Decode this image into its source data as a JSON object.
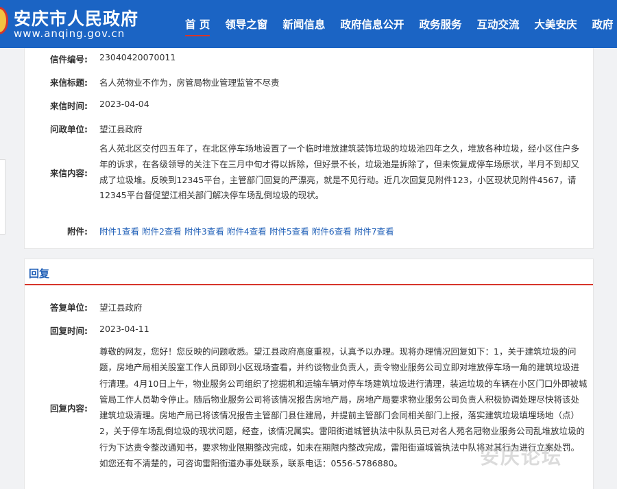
{
  "header": {
    "site_title": "安庆市人民政府",
    "site_url": "www.anqing.gov.cn",
    "nav": [
      {
        "label": "首 页"
      },
      {
        "label": "领导之窗"
      },
      {
        "label": "新闻信息"
      },
      {
        "label": "政府信息公开"
      },
      {
        "label": "政务服务"
      },
      {
        "label": "互动交流"
      },
      {
        "label": "大美安庆"
      },
      {
        "label": "政府"
      }
    ]
  },
  "letter": {
    "number_label": "信件编号:",
    "number_value": "23040420070011",
    "title_label": "来信标题:",
    "title_value": "名人苑物业不作为，房管局物业管理监管不尽责",
    "time_label": "来信时间:",
    "time_value": "2023-04-04",
    "unit_label": "问政单位:",
    "unit_value": "望江县政府",
    "content_label": "来信内容:",
    "content_value": "名人苑北区交付四五年了，在北区停车场地设置了一个临时堆放建筑装饰垃圾的垃圾池四年之久，堆放各种垃圾，经小区住户多年的诉求，在各级领导的关注下在三月中旬才得以拆除，但好景不长，垃圾池是拆除了，但未恢复成停车场原状，半月不到却又成了垃圾堆。反映到12345平台，主管部门回复的严漂亮，就是不见行动。近几次回复见附件123，小区现状见附件4567，请12345平台督促望江相关部门解决停车场乱倒垃圾的现状。",
    "attachments_label": "附件:",
    "attachments": [
      "附件1查看",
      "附件2查看",
      "附件3查看",
      "附件4查看",
      "附件5查看",
      "附件6查看",
      "附件7查看"
    ]
  },
  "reply": {
    "section_title": "回复",
    "unit_label": "答复单位:",
    "unit_value": "望江县政府",
    "time_label": "回复时间:",
    "time_value": "2023-04-11",
    "content_label": "回复内容:",
    "content_value": "尊敬的网友，您好！您反映的问题收悉。望江县政府高度重视，认真予以办理。现将办理情况回复如下：1，关于建筑垃圾的问题，房地产局相关股室工作人员即到小区现场查看，并约谈物业负责人，责令物业服务公司立即对堆放停车场一角的建筑垃圾进行清理。4月10日上午，物业服务公司组织了挖掘机和运输车辆对停车场建筑垃圾进行清理，装运垃圾的车辆在小区门口外即被城管局工作人员勒令停止。随后物业服务公司将该情况报告房地产局，房地产局要求物业服务公司负责人积极协调处理尽快将该处建筑垃圾清理。房地产局已将该情况报告主管部门县住建局，并提前主管部门会同相关部门上报，落实建筑垃圾填埋场地（点）2，关于停车场乱倒垃圾的现状问题，经查，该情况属实。雷阳街道城管执法中队队员已对名人苑名冠物业服务公司乱堆放垃圾的行为下达责令整改通知书，要求物业限期整改完成，如未在期限内整改完成，雷阳街道城管执法中队将对其行为进行立案处罚。如您还有不清楚的，可咨询雷阳街道办事处联系，联系电话：0556-5786880。"
  },
  "watermark": "安庆论坛"
}
